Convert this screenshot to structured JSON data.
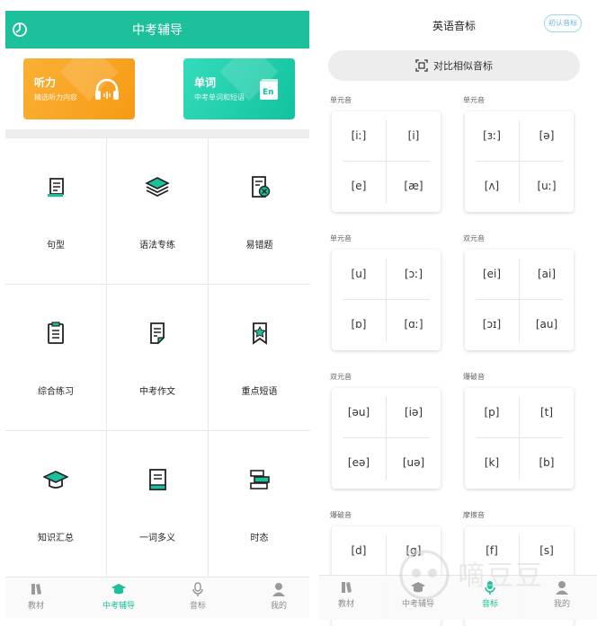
{
  "left": {
    "title": "中考辅导",
    "cards": [
      {
        "title": "听力",
        "subtitle": "精选听力内容"
      },
      {
        "title": "单词",
        "subtitle": "中考单词和短语",
        "badge": "En"
      }
    ],
    "grid": [
      {
        "label": "句型",
        "icon": "scroll-icon"
      },
      {
        "label": "语法专练",
        "icon": "layers-icon"
      },
      {
        "label": "易错题",
        "icon": "error-doc-icon"
      },
      {
        "label": "综合练习",
        "icon": "clipboard-icon"
      },
      {
        "label": "中考作文",
        "icon": "document-icon"
      },
      {
        "label": "重点短语",
        "icon": "bookmark-star-icon"
      },
      {
        "label": "知识汇总",
        "icon": "graduation-cap-icon"
      },
      {
        "label": "一词多义",
        "icon": "book-icon"
      },
      {
        "label": "时态",
        "icon": "books-stack-icon"
      }
    ],
    "nav": [
      "教材",
      "中考辅导",
      "音标",
      "我的"
    ]
  },
  "right": {
    "title": "英语音标",
    "badge": "初认音标",
    "compare": "对比相似音标",
    "groups": [
      {
        "label": "单元音",
        "phonemes": [
          "[iː]",
          "[i]",
          "[e]",
          "[æ]"
        ]
      },
      {
        "label": "单元音",
        "phonemes": [
          "[ɜː]",
          "[ə]",
          "[ʌ]",
          "[uː]"
        ]
      },
      {
        "label": "单元音",
        "phonemes": [
          "[u]",
          "[ɔː]",
          "[ɒ]",
          "[ɑː]"
        ]
      },
      {
        "label": "双元音",
        "phonemes": [
          "[ei]",
          "[ai]",
          "[ɔɪ]",
          "[au]"
        ]
      },
      {
        "label": "双元音",
        "phonemes": [
          "[əu]",
          "[iə]",
          "[eə]",
          "[uə]"
        ]
      },
      {
        "label": "爆破音",
        "phonemes": [
          "[p]",
          "[t]",
          "[k]",
          "[b]"
        ]
      },
      {
        "label": "爆破音",
        "phonemes": [
          "[d]",
          "[g]",
          "",
          ""
        ]
      },
      {
        "label": "摩擦音",
        "phonemes": [
          "[f]",
          "[s]",
          "",
          ""
        ]
      }
    ],
    "nav": [
      "教材",
      "中考辅导",
      "音标",
      "我的"
    ],
    "watermark": "嘀豆豆"
  },
  "colors": {
    "accent": "#1cc09b",
    "orange": "#f8a21c",
    "inactive": "#8d8d8d"
  }
}
